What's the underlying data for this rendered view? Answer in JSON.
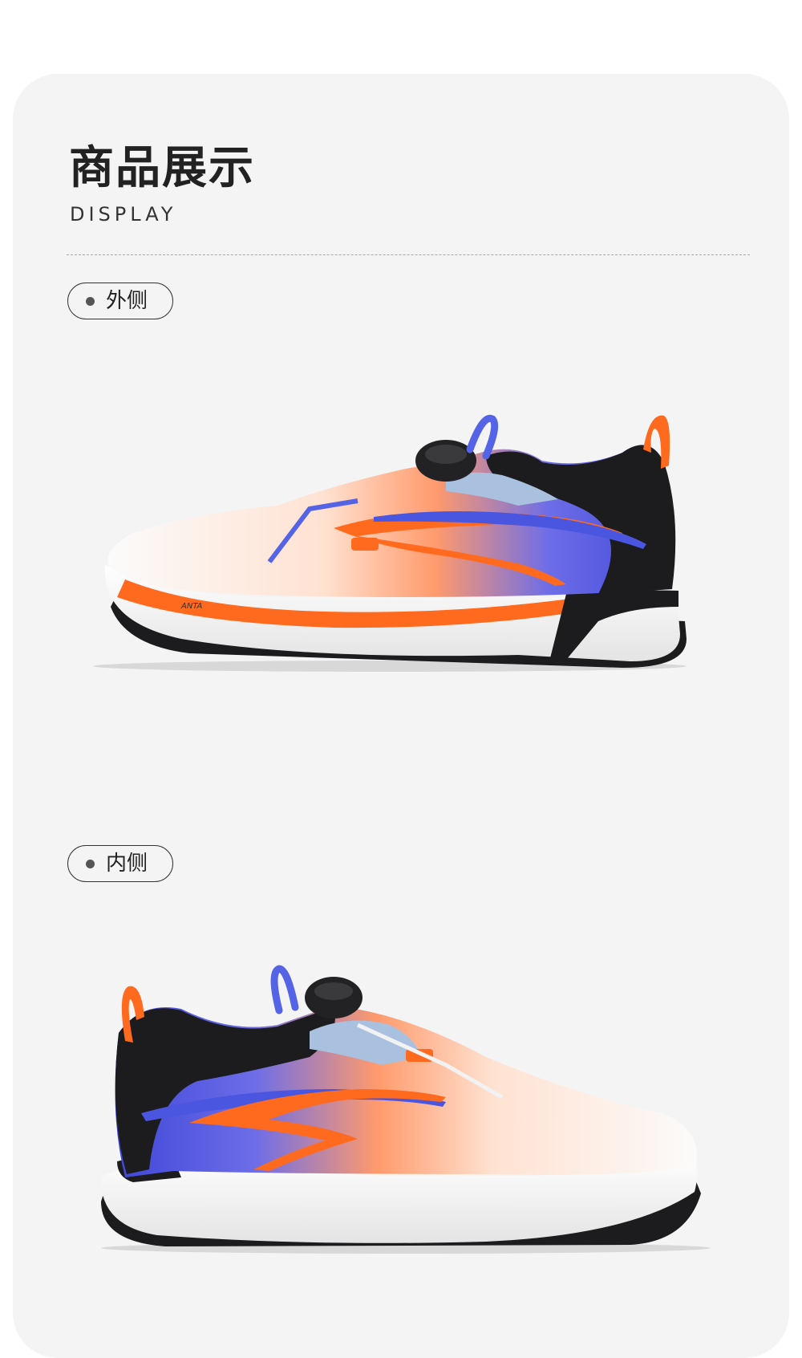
{
  "section": {
    "title": "商品展示",
    "subtitle": "DISPLAY"
  },
  "views": [
    {
      "label": "外侧",
      "image": "shoe-lateral-side",
      "brand_mark": "ANTA"
    },
    {
      "label": "内侧",
      "image": "shoe-medial-side"
    }
  ],
  "colors": {
    "card_background": "#f4f4f4",
    "title_text": "#222222",
    "accent_orange": "#ff6a1f",
    "accent_blue": "#5564e6",
    "upper_black": "#1c1c1e"
  }
}
